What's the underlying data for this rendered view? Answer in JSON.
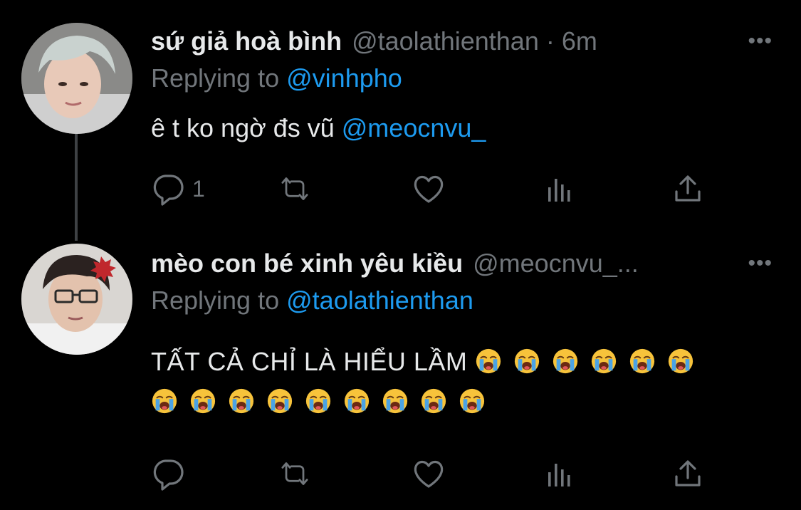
{
  "tweets": [
    {
      "display_name": "sứ giả hoà bình",
      "handle": "@taolathienthan",
      "separator": "·",
      "time": "6m",
      "more_label": "•••",
      "replying_prefix": "Replying to",
      "replying_to": "@vinhpho",
      "text": "ê t ko ngờ đs vũ",
      "text_mention": "@meocnvu_",
      "reply_count": "1",
      "avatar_icon": "avatar-gray-hair-person"
    },
    {
      "display_name": "mèo con bé xinh yêu kiều",
      "handle": "@meocnvu_...",
      "more_label": "•••",
      "replying_prefix": "Replying to",
      "replying_to": "@taolathienthan",
      "text": "TẤT CẢ CHỈ LÀ HIỂU LẦM",
      "emoji_name": "loudly-crying-face-emoji",
      "emoji_count_line1": 6,
      "emoji_count_line2": 9,
      "reply_count": "",
      "avatar_icon": "avatar-glasses-person"
    }
  ],
  "colors": {
    "background": "#000000",
    "text": "#e7e9ea",
    "secondary": "#71767b",
    "link": "#1d9bf0",
    "thread_line": "#3e4144"
  }
}
